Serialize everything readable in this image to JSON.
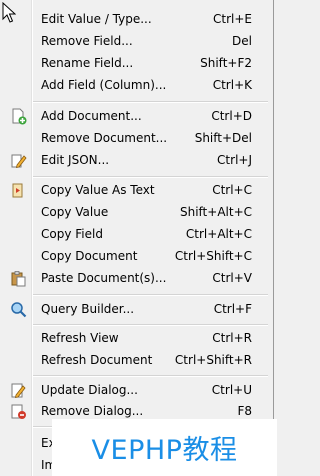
{
  "menu": {
    "items": [
      {
        "label": "Edit Value / Type...",
        "shortcut": "Ctrl+E"
      },
      {
        "label": "Remove Field...",
        "shortcut": "Del"
      },
      {
        "label": "Rename Field...",
        "shortcut": "Shift+F2"
      },
      {
        "label": "Add Field (Column)...",
        "shortcut": "Ctrl+K"
      },
      {
        "label": "Add Document...",
        "shortcut": "Ctrl+D",
        "icon": "add-document-icon"
      },
      {
        "label": "Remove Document...",
        "shortcut": "Shift+Del"
      },
      {
        "label": "Edit JSON...",
        "shortcut": "Ctrl+J",
        "icon": "edit-json-icon"
      },
      {
        "label": "Copy Value As Text",
        "shortcut": "Ctrl+C",
        "icon": "copy-text-icon"
      },
      {
        "label": "Copy Value",
        "shortcut": "Shift+Alt+C"
      },
      {
        "label": "Copy Field",
        "shortcut": "Ctrl+Alt+C"
      },
      {
        "label": "Copy Document",
        "shortcut": "Ctrl+Shift+C"
      },
      {
        "label": "Paste Document(s)...",
        "shortcut": "Ctrl+V",
        "icon": "paste-icon"
      },
      {
        "label": "Query Builder...",
        "shortcut": "Ctrl+F",
        "icon": "magnifier-icon"
      },
      {
        "label": "Refresh View",
        "shortcut": "Ctrl+R"
      },
      {
        "label": "Refresh Document",
        "shortcut": "Ctrl+Shift+R"
      },
      {
        "label": "Update Dialog...",
        "shortcut": "Ctrl+U",
        "icon": "update-dialog-icon"
      },
      {
        "label": "Remove Dialog...",
        "shortcut": "F8",
        "icon": "remove-dialog-icon"
      },
      {
        "label": "Ex",
        "shortcut": ""
      },
      {
        "label": "Im",
        "shortcut": ""
      }
    ]
  },
  "watermark": {
    "text": "VEPHP教程",
    "color": "#1a8ee6"
  },
  "colors": {
    "menu_bg": "#f0f0f0",
    "separator": "#d4d4d4"
  }
}
